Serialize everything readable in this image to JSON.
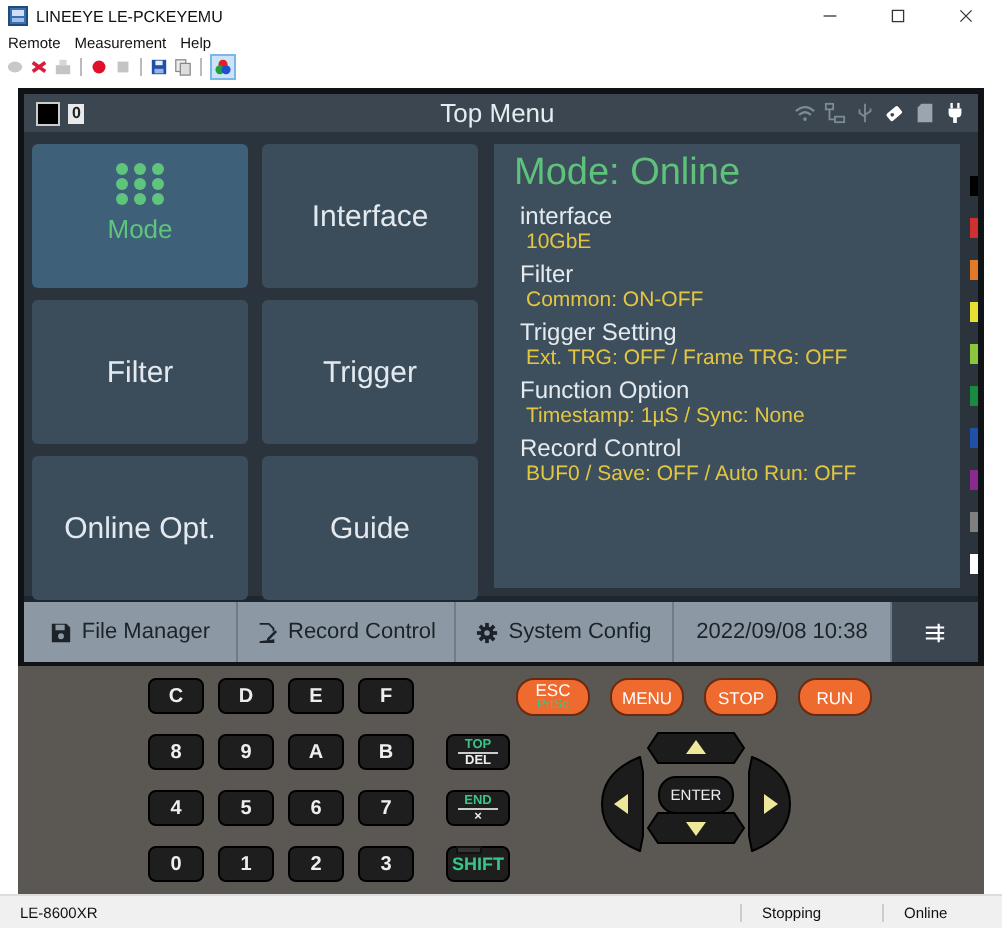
{
  "window": {
    "title": "LINEEYE LE-PCKEYEMU"
  },
  "menu": [
    "Remote",
    "Measurement",
    "Help"
  ],
  "toolbar": [
    {
      "kind": "connect",
      "disabled": true
    },
    {
      "kind": "disconnect",
      "disabled": false
    },
    {
      "kind": "device",
      "disabled": true
    },
    {
      "kind": "sep"
    },
    {
      "kind": "record",
      "disabled": false
    },
    {
      "kind": "stop",
      "disabled": true
    },
    {
      "kind": "sep"
    },
    {
      "kind": "save",
      "disabled": false
    },
    {
      "kind": "copy",
      "disabled": false
    },
    {
      "kind": "sep"
    },
    {
      "kind": "color",
      "disabled": false,
      "selected": true
    }
  ],
  "screen": {
    "indicator": "0",
    "title": "Top Menu",
    "status_icons": [
      {
        "kind": "wifi",
        "active": false
      },
      {
        "kind": "lan",
        "active": false
      },
      {
        "kind": "usb",
        "active": false
      },
      {
        "kind": "usb-stick",
        "active": true
      },
      {
        "kind": "sd-card",
        "active": false
      },
      {
        "kind": "plug",
        "active": true
      }
    ],
    "tiles": [
      {
        "label": "Mode",
        "selected": true,
        "kind": "icon"
      },
      {
        "label": "Interface",
        "selected": false,
        "kind": "plain"
      },
      {
        "label": "Filter",
        "selected": false,
        "kind": "plain"
      },
      {
        "label": "Trigger",
        "selected": false,
        "kind": "plain"
      },
      {
        "label": "Online Opt.",
        "selected": false,
        "kind": "plain"
      },
      {
        "label": "Guide",
        "selected": false,
        "kind": "plain"
      }
    ],
    "info": {
      "title": "Mode: Online",
      "items": [
        {
          "label": "interface",
          "value": "10GbE"
        },
        {
          "label": "Filter",
          "value": "Common: ON-OFF"
        },
        {
          "label": "Trigger Setting",
          "value": "Ext. TRG: OFF / Frame TRG: OFF"
        },
        {
          "label": "Function Option",
          "value": "Timestamp: 1µS / Sync: None"
        },
        {
          "label": "Record Control",
          "value": "BUF0 / Save: OFF / Auto Run: OFF"
        }
      ]
    },
    "color_marks": [
      {
        "color": "#000000"
      },
      {
        "color": "#d03030"
      },
      {
        "color": "#e07a28"
      },
      {
        "color": "#e8e030"
      },
      {
        "color": "#8cc63c"
      },
      {
        "color": "#1a8a40"
      },
      {
        "color": "#2050a8"
      },
      {
        "color": "#8a2a90"
      },
      {
        "color": "#808080"
      },
      {
        "color": "#ffffff"
      }
    ],
    "bottom_bar": [
      {
        "kind": "file",
        "label": "File Manager"
      },
      {
        "kind": "record",
        "label": "Record Control"
      },
      {
        "kind": "gear",
        "label": "System Config"
      },
      {
        "kind": "date",
        "label": "2022/09/08  10:38"
      },
      {
        "kind": "menu"
      }
    ]
  },
  "keypad": {
    "hex_keys": [
      "C",
      "D",
      "E",
      "F",
      "8",
      "9",
      "A",
      "B",
      "4",
      "5",
      "6",
      "7",
      "0",
      "1",
      "2",
      "3"
    ],
    "side_keys": [
      {
        "kind": "split",
        "top": "TOP",
        "bottom": "DEL"
      },
      {
        "kind": "split",
        "top": "END",
        "bottom": "×"
      },
      {
        "kind": "single",
        "top": "SHIFT"
      }
    ],
    "function_keys": [
      {
        "label": "ESC",
        "sub": "PrtSc"
      },
      {
        "label": "MENU"
      },
      {
        "label": "STOP"
      },
      {
        "label": "RUN"
      }
    ],
    "enter_key": "ENTER"
  },
  "status_bar": [
    "LE-8600XR",
    "Stopping",
    "Online"
  ]
}
